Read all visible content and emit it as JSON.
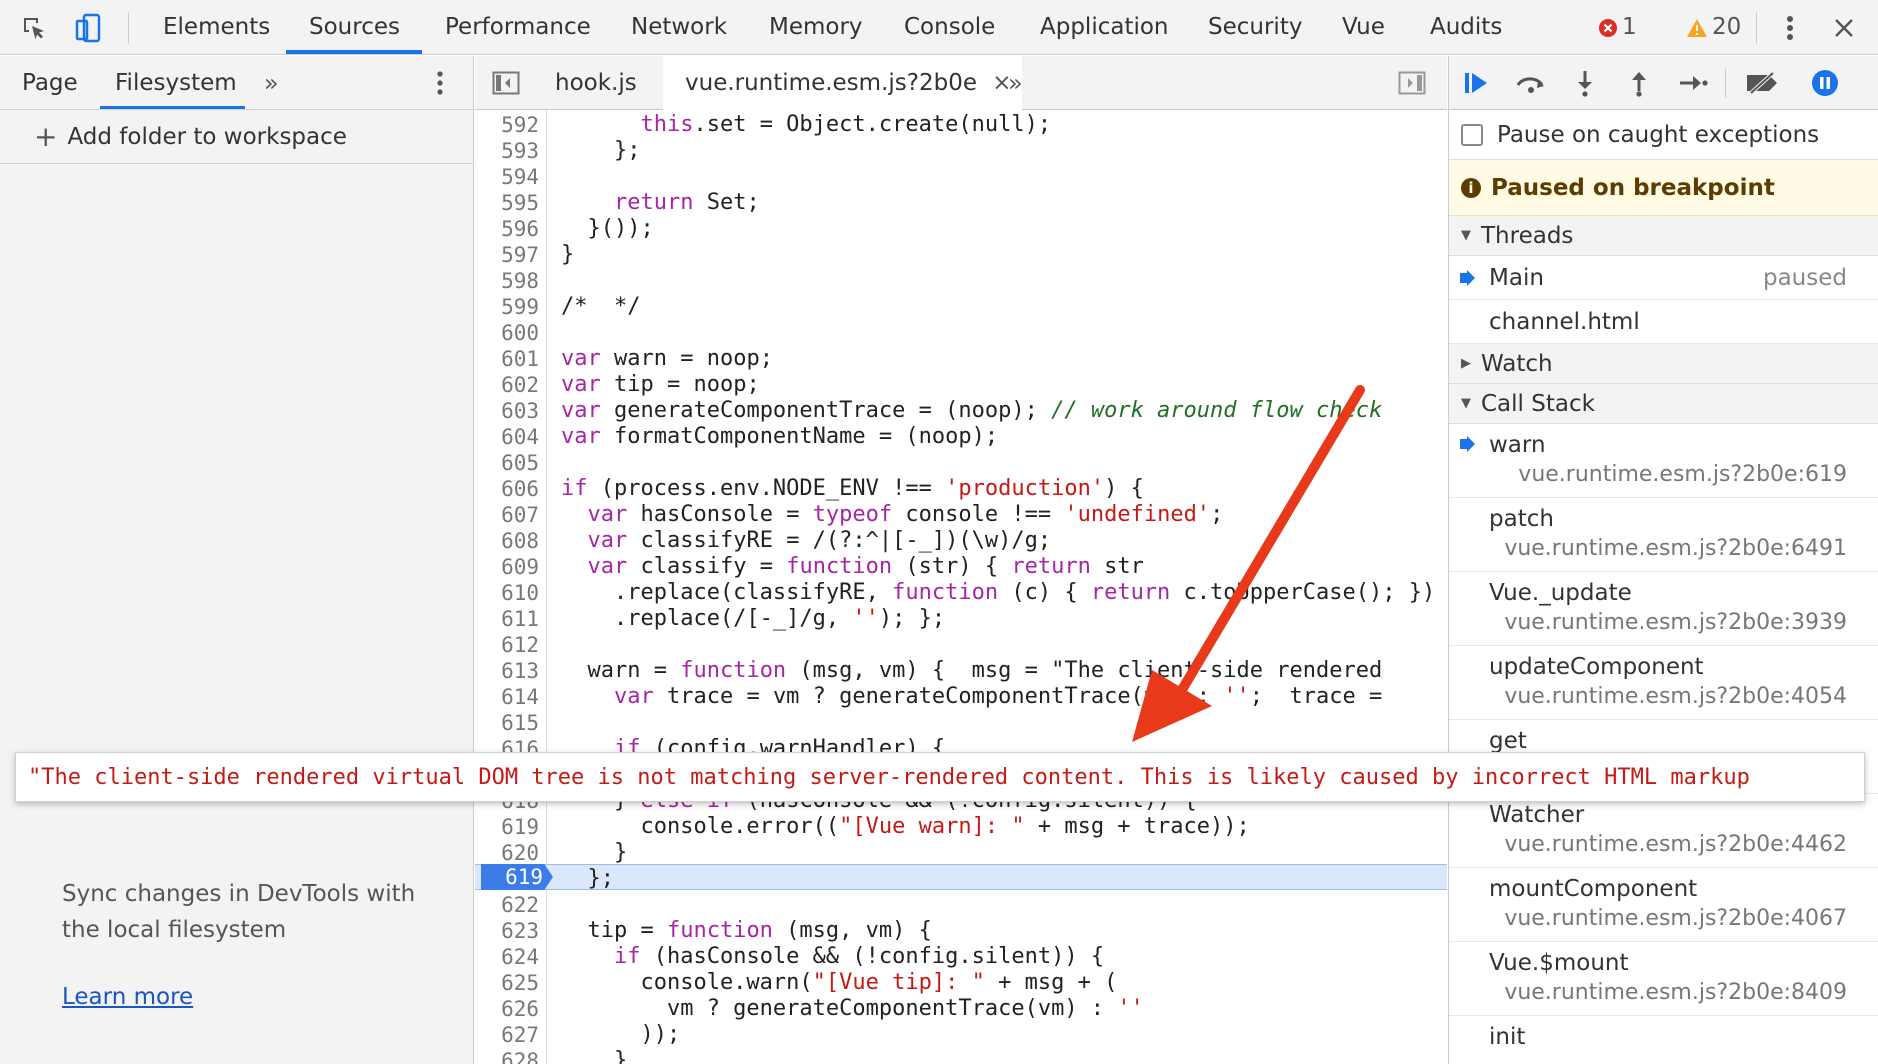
{
  "toolbar": {
    "tabs": [
      "Elements",
      "Sources",
      "Performance",
      "Network",
      "Memory",
      "Console",
      "Application",
      "Security",
      "Vue",
      "Audits"
    ],
    "errors": "1",
    "warnings": "20"
  },
  "navigator": {
    "tabs": [
      "Page",
      "Filesystem"
    ],
    "add_folder": "Add folder to workspace",
    "sync_text": "Sync changes in DevTools with the local filesystem",
    "learn_more": "Learn more"
  },
  "editor": {
    "tabs": [
      "hook.js",
      "vue.runtime.esm.js?2b0e"
    ],
    "current_line": "619",
    "lines": [
      {
        "n": "592",
        "t": "      this.set = Object.create(null);"
      },
      {
        "n": "593",
        "t": "    };"
      },
      {
        "n": "594",
        "t": ""
      },
      {
        "n": "595",
        "t": "    return Set;"
      },
      {
        "n": "596",
        "t": "  }());"
      },
      {
        "n": "597",
        "t": "}"
      },
      {
        "n": "598",
        "t": ""
      },
      {
        "n": "599",
        "t": "/*  */"
      },
      {
        "n": "600",
        "t": ""
      },
      {
        "n": "601",
        "t": "var warn = noop;"
      },
      {
        "n": "602",
        "t": "var tip = noop;"
      },
      {
        "n": "603",
        "t": "var generateComponentTrace = (noop); // work around flow check"
      },
      {
        "n": "604",
        "t": "var formatComponentName = (noop);"
      },
      {
        "n": "605",
        "t": ""
      },
      {
        "n": "606",
        "t": "if (process.env.NODE_ENV !== 'production') {"
      },
      {
        "n": "607",
        "t": "  var hasConsole = typeof console !== 'undefined';"
      },
      {
        "n": "608",
        "t": "  var classifyRE = /(?:^|[-_])(\\w)/g;"
      },
      {
        "n": "609",
        "t": "  var classify = function (str) { return str"
      },
      {
        "n": "610",
        "t": "    .replace(classifyRE, function (c) { return c.toUpperCase(); })"
      },
      {
        "n": "611",
        "t": "    .replace(/[-_]/g, ''); };"
      },
      {
        "n": "612",
        "t": ""
      },
      {
        "n": "613",
        "t": "  warn = function (msg, vm) {  msg = \"The client-side rendered"
      },
      {
        "n": "614",
        "t": "    var trace = vm ? generateComponentTrace(vm) : '';  trace = "
      },
      {
        "n": "615",
        "t": ""
      },
      {
        "n": "616",
        "t": "    if (config.warnHandler) {"
      },
      {
        "n": "617",
        "t": ""
      },
      {
        "n": "618",
        "t": "    } else if (hasConsole && (!config.silent)) {"
      },
      {
        "n": "619",
        "t": "      console.error((\"[Vue warn]: \" + msg + trace));"
      },
      {
        "n": "620",
        "t": "    }"
      },
      {
        "n": "621",
        "t": "  };"
      },
      {
        "n": "622",
        "t": ""
      },
      {
        "n": "623",
        "t": "  tip = function (msg, vm) {"
      },
      {
        "n": "624",
        "t": "    if (hasConsole && (!config.silent)) {"
      },
      {
        "n": "625",
        "t": "      console.warn(\"[Vue tip]: \" + msg + ("
      },
      {
        "n": "626",
        "t": "        vm ? generateComponentTrace(vm) : ''"
      },
      {
        "n": "627",
        "t": "      ));"
      },
      {
        "n": "628",
        "t": "    }"
      }
    ]
  },
  "debugger": {
    "pause_caught": "Pause on caught exceptions",
    "paused_banner": "Paused on breakpoint",
    "threads_header": "Threads",
    "threads": [
      {
        "name": "Main",
        "status": "paused"
      },
      {
        "name": "channel.html",
        "status": ""
      }
    ],
    "watch_header": "Watch",
    "callstack_header": "Call Stack",
    "frames": [
      {
        "name": "warn",
        "loc": "vue.runtime.esm.js?2b0e:619"
      },
      {
        "name": "patch",
        "loc": "vue.runtime.esm.js?2b0e:6491"
      },
      {
        "name": "Vue._update",
        "loc": "vue.runtime.esm.js?2b0e:3939"
      },
      {
        "name": "updateComponent",
        "loc": "vue.runtime.esm.js?2b0e:4054"
      },
      {
        "name": "get",
        "loc": ""
      },
      {
        "name": "Watcher",
        "loc": "vue.runtime.esm.js?2b0e:4462"
      },
      {
        "name": "mountComponent",
        "loc": "vue.runtime.esm.js?2b0e:4067"
      },
      {
        "name": "Vue.$mount",
        "loc": "vue.runtime.esm.js?2b0e:8409"
      },
      {
        "name": "init",
        "loc": ""
      }
    ]
  },
  "console_error": "\"The client-side rendered virtual DOM tree is not matching server-rendered content. This is likely caused by incorrect HTML markup"
}
